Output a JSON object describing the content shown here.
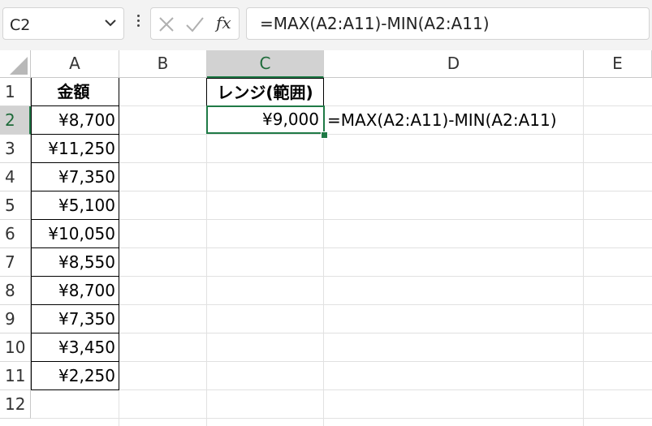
{
  "formula_bar": {
    "name_box": "C2",
    "formula": "=MAX(A2:A11)-MIN(A2:A11)"
  },
  "columns": [
    "A",
    "B",
    "C",
    "D",
    "E"
  ],
  "selected_column": "C",
  "rows": [
    "1",
    "2",
    "3",
    "4",
    "5",
    "6",
    "7",
    "8",
    "9",
    "10",
    "11",
    "12"
  ],
  "selected_row": "2",
  "cells": {
    "A1": "金額",
    "A": [
      "¥8,700",
      "¥11,250",
      "¥7,350",
      "¥5,100",
      "¥10,050",
      "¥8,550",
      "¥8,700",
      "¥7,350",
      "¥3,450",
      "¥2,250"
    ],
    "C1": "レンジ(範囲)",
    "C2": "¥9,000",
    "D2": "=MAX(A2:A11)-MIN(A2:A11)"
  },
  "colors": {
    "accent": "#1f7a46",
    "header_selected": "#d2d2d2"
  }
}
